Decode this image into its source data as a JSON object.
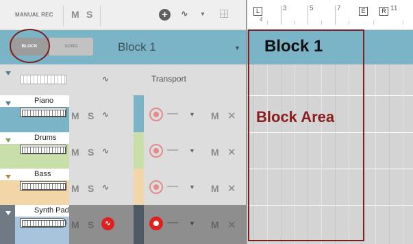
{
  "toolbar": {
    "manual_rec_label": "MANUAL REC",
    "mute_label": "M",
    "solo_label": "S",
    "add_icon": "plus-circle-icon",
    "automation_icon": "waveform-icon",
    "grid_icon": "grid-icon"
  },
  "mode": {
    "block_label": "BLOCK",
    "song_label": "SONG",
    "active": "BLOCK"
  },
  "block_selector": {
    "value": "Block 1"
  },
  "ruler": {
    "bar_numbers": [
      "3",
      "5",
      "7",
      "11"
    ],
    "left_marker": "L",
    "left_sub": "4",
    "end_marker": "E",
    "right_marker": "R"
  },
  "block_area": {
    "title": "Block 1",
    "annotation": "Block Area"
  },
  "transport": {
    "label": "Transport"
  },
  "tracks": [
    {
      "name": "Piano",
      "mute": "M",
      "solo": "S",
      "dash": "—",
      "m": "M",
      "x": "✕",
      "color": "#7ab4c6",
      "bg": "#dddddd"
    },
    {
      "name": "Drums",
      "mute": "M",
      "solo": "S",
      "dash": "—",
      "m": "M",
      "x": "✕",
      "color": "#c8dfa9",
      "bg": "#dddddd"
    },
    {
      "name": "Bass",
      "mute": "M",
      "solo": "S",
      "dash": "—",
      "m": "M",
      "x": "✕",
      "color": "#f3d6a8",
      "bg": "#dddddd"
    },
    {
      "name": "Synth Pad",
      "mute": "M",
      "solo": "S",
      "dash": "—",
      "m": "M",
      "x": "✕",
      "color": "#a7c4dc",
      "bg": "#8e8e8e"
    }
  ],
  "colors": {
    "header_blue": "#7ab4c6",
    "annotation_red": "#7a2020",
    "record_red": "#e0201f"
  }
}
